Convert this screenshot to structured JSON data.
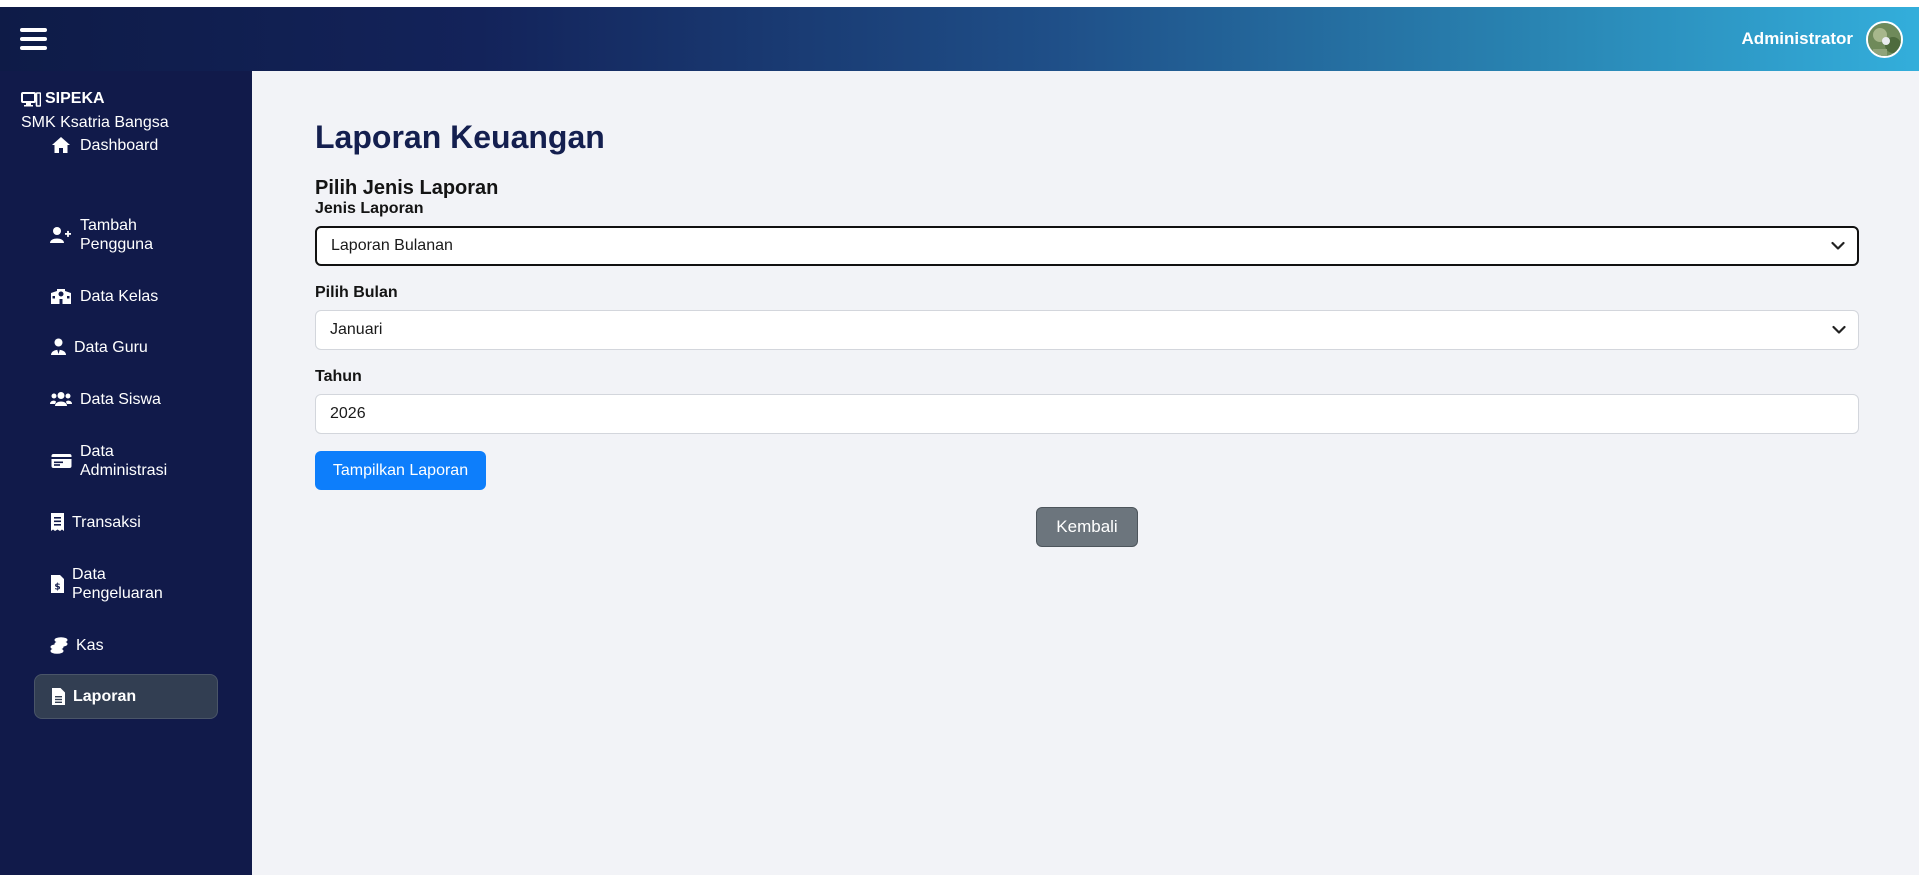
{
  "header": {
    "user_name": "Administrator"
  },
  "sidebar": {
    "brand_title": "SIPEKA",
    "brand_subtitle": "SMK Ksatria Bangsa",
    "items": [
      {
        "label": "Dashboard",
        "icon": "home-icon"
      },
      {
        "label": "Tambah Pengguna",
        "icon": "user-plus-icon"
      },
      {
        "label": "Data Kelas",
        "icon": "school-icon"
      },
      {
        "label": "Data Guru",
        "icon": "user-tie-icon"
      },
      {
        "label": "Data Siswa",
        "icon": "users-icon"
      },
      {
        "label": "Data Administrasi",
        "icon": "id-card-icon"
      },
      {
        "label": "Transaksi",
        "icon": "receipt-icon"
      },
      {
        "label": "Data Pengeluaran",
        "icon": "file-invoice-dollar-icon"
      },
      {
        "label": "Kas",
        "icon": "coins-icon"
      },
      {
        "label": "Laporan",
        "icon": "file-icon",
        "active": true
      }
    ]
  },
  "main": {
    "title": "Laporan Keuangan",
    "section_title": "Pilih Jenis Laporan",
    "report_type": {
      "label": "Jenis Laporan",
      "value": "Laporan Bulanan"
    },
    "month": {
      "label": "Pilih Bulan",
      "value": "Januari"
    },
    "year": {
      "label": "Tahun",
      "value": "2026"
    },
    "show_button": "Tampilkan Laporan",
    "back_button": "Kembali"
  },
  "colors": {
    "sidebar_bg": "#111a4a",
    "primary": "#0d7efb",
    "secondary": "#6c757d",
    "title": "#141f4f"
  }
}
